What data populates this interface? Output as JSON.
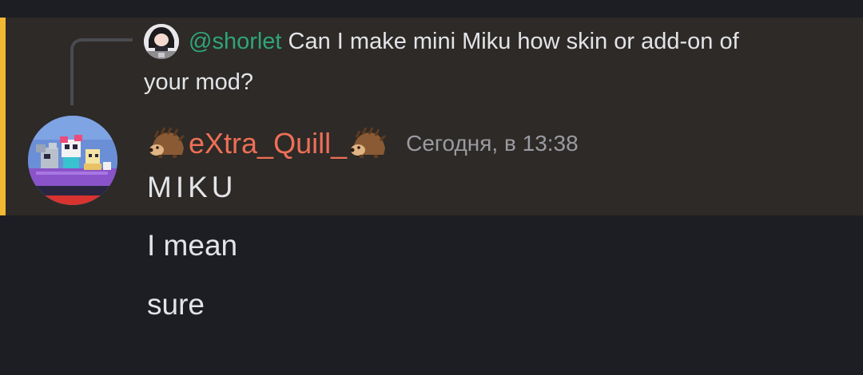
{
  "reply": {
    "mention": "@shorlet",
    "text_line1": "Can I make mini Miku how skin or add-on of",
    "text_line2": "your mod?",
    "avatar_icon": "reply-user-avatar"
  },
  "message": {
    "username": "eXtra_Quill_",
    "name_decoration_icon": "hedgehog-emoji",
    "timestamp": "Сегодня, в 13:38",
    "avatar_icon": "pixel-art-avatar",
    "lines": [
      "MIKU",
      "I mean",
      "sure"
    ]
  },
  "colors": {
    "background": "#1d1e23",
    "highlight_background": "#2d2a27",
    "highlight_accent": "#f2b833",
    "mention": "#2fa47b",
    "username": "#ee6f56",
    "timestamp": "#9a9ba1",
    "text": "#e3e4e8"
  }
}
